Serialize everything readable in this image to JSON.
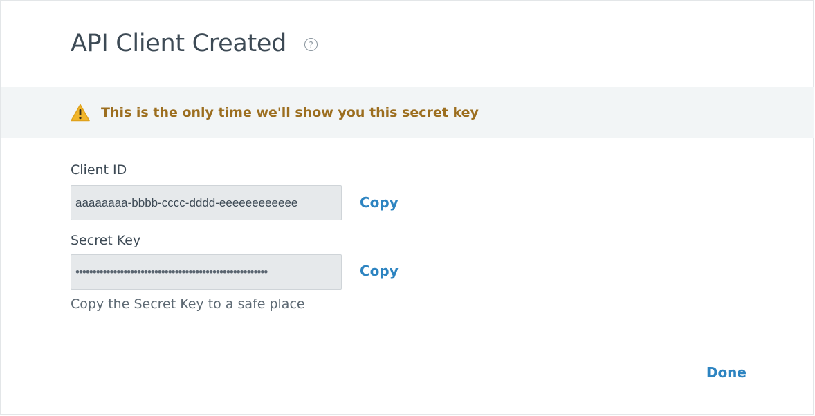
{
  "dialog": {
    "title": "API Client Created",
    "help_icon": "question-circle-icon",
    "warning": {
      "icon": "warning-triangle-icon",
      "text": "This is the only time we'll show you this secret key",
      "color": "#9c6e1f",
      "icon_color": "#f0b52b"
    },
    "client_id": {
      "label": "Client ID",
      "value": "aaaaaaaa-bbbb-cccc-dddd-eeeeeeeeeeee",
      "copy_label": "Copy"
    },
    "secret_key": {
      "label": "Secret Key",
      "value": "••••••••••••••••••••••••••••••••••••••••••••••••••••••••",
      "copy_label": "Copy",
      "hint": "Copy the Secret Key to a safe place"
    },
    "done_label": "Done",
    "accent_color": "#2d84c1"
  }
}
